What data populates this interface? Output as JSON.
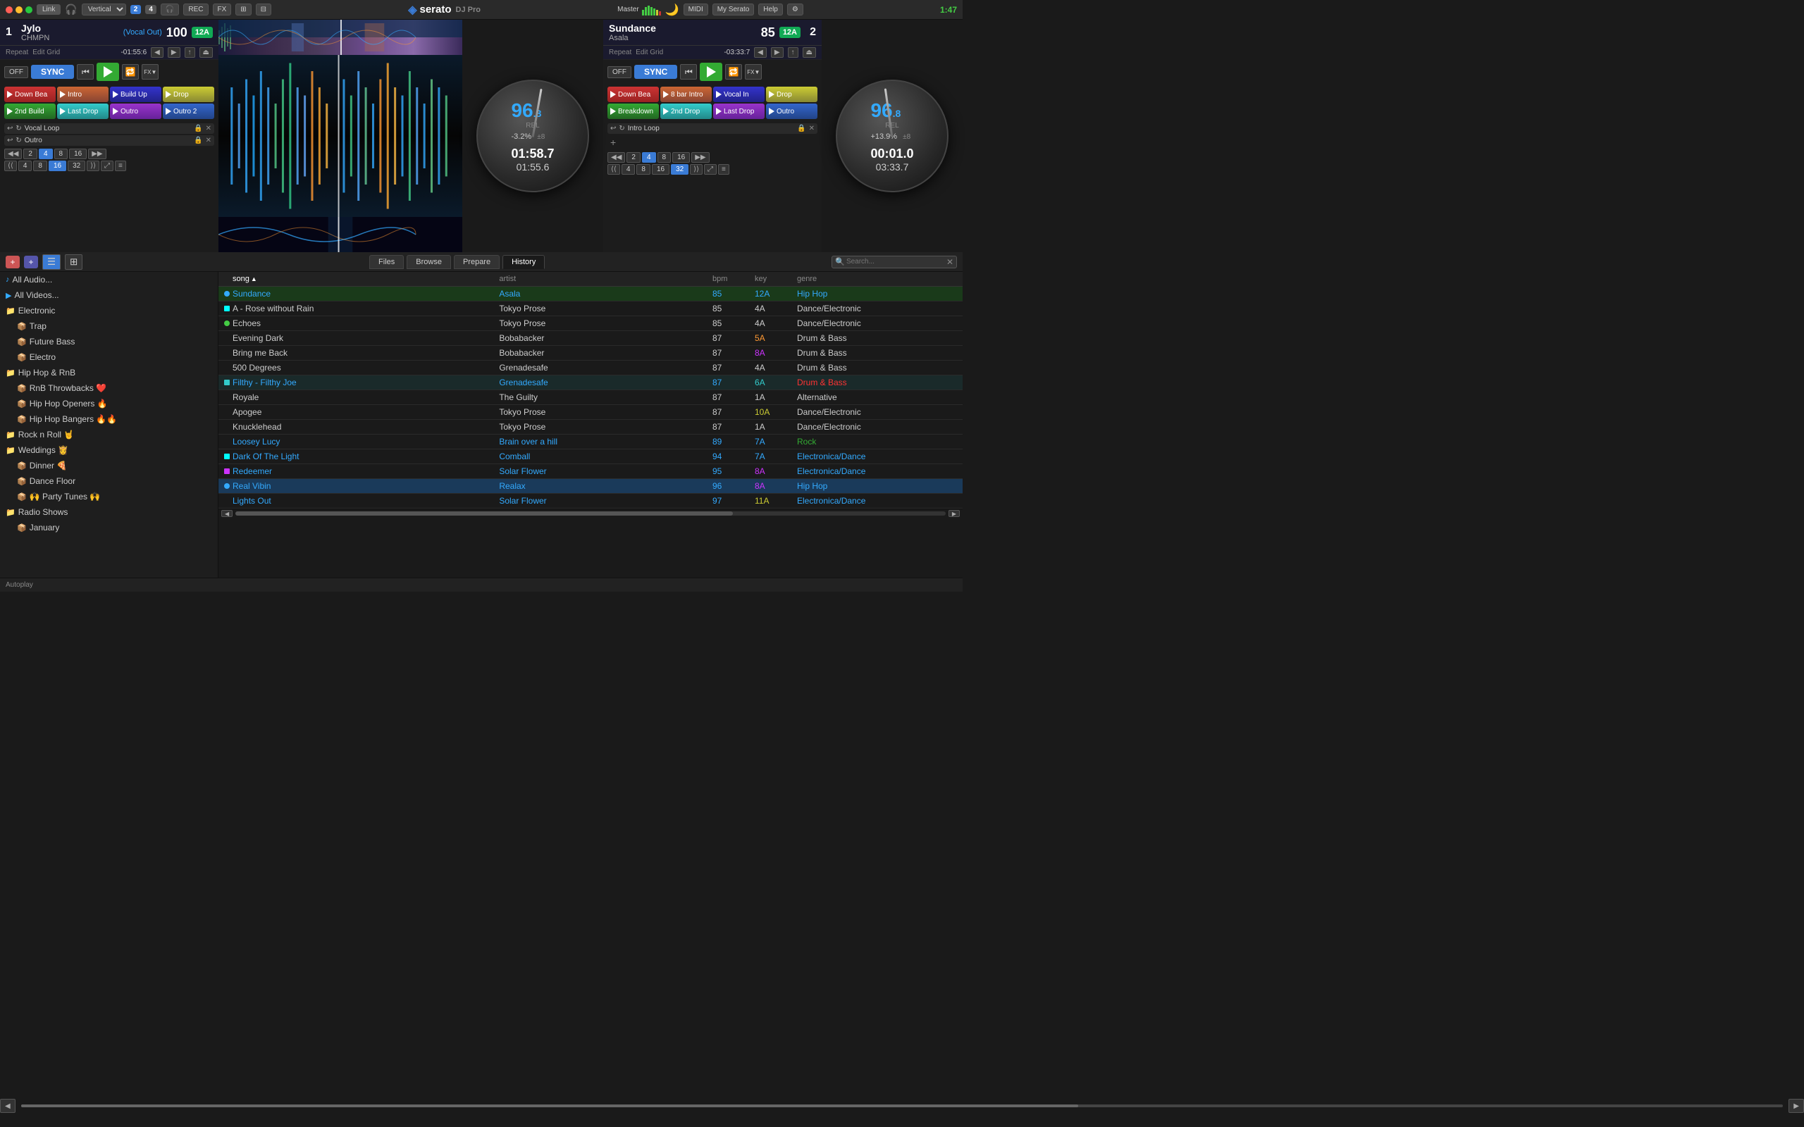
{
  "topbar": {
    "link_label": "Link",
    "layout_label": "Vertical",
    "badge1": "2",
    "badge2": "4",
    "rec_label": "REC",
    "fx_label": "FX",
    "midi_label": "MIDI",
    "myserato_label": "My Serato",
    "help_label": "Help",
    "settings_label": "⚙",
    "time": "1:47"
  },
  "deck1": {
    "num": "1",
    "title": "Jylo",
    "artist": "CHMPN",
    "cue": "(Vocal Out)",
    "bpm": "100",
    "key": "12A",
    "repeat_label": "Repeat",
    "edit_grid_label": "Edit Grid",
    "time_remaining": "-01:55:6",
    "time_elapsed": "01:58.7",
    "time_total": "01:55.6",
    "pitch_value": "-3.2%",
    "pitch_range": "±8",
    "platter_bpm": "96",
    "platter_bpm_dec": ".8",
    "platter_rel": "REL",
    "cue_points": [
      {
        "label": "Down Bea",
        "color": "red"
      },
      {
        "label": "Intro",
        "color": "orange"
      },
      {
        "label": "Build Up",
        "color": "blue"
      },
      {
        "label": "Drop",
        "color": "yellow"
      },
      {
        "label": "2nd Build",
        "color": "green"
      },
      {
        "label": "Last Drop",
        "color": "teal"
      },
      {
        "label": "Outro",
        "color": "purple"
      },
      {
        "label": "Outro 2",
        "color": "darkblue"
      }
    ],
    "loops": [
      {
        "label": "Vocal Loop"
      },
      {
        "label": "Outro"
      }
    ],
    "beat_nums": [
      "2",
      "4",
      "8",
      "16"
    ],
    "beat_nums2": [
      "4",
      "8",
      "16",
      "32"
    ],
    "active_beat": "4",
    "active_beat2": "16"
  },
  "deck2": {
    "num": "2",
    "title": "Sundance",
    "artist": "Asala",
    "cue": "",
    "bpm": "85",
    "key": "12A",
    "repeat_label": "Repeat",
    "edit_grid_label": "Edit Grid",
    "time_remaining": "-03:33:7",
    "time_elapsed": "00:01.0",
    "time_total": "03:33.7",
    "pitch_value": "+13.9%",
    "pitch_range": "±8",
    "platter_bpm": "96",
    "platter_bpm_dec": ".8",
    "platter_rel": "REL",
    "cue_points": [
      {
        "label": "Down Bea",
        "color": "red"
      },
      {
        "label": "8 bar Intro",
        "color": "orange"
      },
      {
        "label": "Vocal In",
        "color": "blue"
      },
      {
        "label": "Drop",
        "color": "yellow"
      },
      {
        "label": "Breakdown",
        "color": "green"
      },
      {
        "label": "2nd Drop",
        "color": "teal"
      },
      {
        "label": "Last Drop",
        "color": "purple"
      },
      {
        "label": "Outro",
        "color": "darkblue"
      }
    ],
    "loops": [
      {
        "label": "Intro Loop"
      }
    ],
    "beat_nums": [
      "2",
      "4",
      "8",
      "16"
    ],
    "beat_nums2": [
      "4",
      "8",
      "16",
      "32"
    ],
    "active_beat": "4",
    "active_beat2": "32"
  },
  "browser": {
    "tabs": [
      "Files",
      "Browse",
      "Prepare",
      "History"
    ],
    "active_tab": "History",
    "search_placeholder": "🔍",
    "columns": {
      "song": "song",
      "artist": "artist",
      "bpm": "bpm",
      "key": "key",
      "genre": "genre"
    },
    "tracks": [
      {
        "id": 1,
        "song": "Sundance",
        "artist": "Asala",
        "bpm": "85",
        "key": "12A",
        "genre": "Hip Hop",
        "highlight": true,
        "indicator": "blue"
      },
      {
        "id": 2,
        "song": "A - Rose without Rain",
        "artist": "Tokyo Prose",
        "bpm": "85",
        "key": "4A",
        "genre": "Dance/Electronic",
        "indicator": "cyan"
      },
      {
        "id": 3,
        "song": "Echoes",
        "artist": "Tokyo Prose",
        "bpm": "85",
        "key": "4A",
        "genre": "Dance/Electronic",
        "indicator": "green"
      },
      {
        "id": 4,
        "song": "Evening Dark",
        "artist": "Bobabacker",
        "bpm": "87",
        "key": "5A",
        "genre": "Drum & Bass"
      },
      {
        "id": 5,
        "song": "Bring me Back",
        "artist": "Bobabacker",
        "bpm": "87",
        "key": "8A",
        "genre": "Drum & Bass"
      },
      {
        "id": 6,
        "song": "500 Degrees",
        "artist": "Grenadesafe",
        "bpm": "87",
        "key": "4A",
        "genre": "Drum & Bass"
      },
      {
        "id": 7,
        "song": "Filthy - Filthy Joe",
        "artist": "Grenadesafe",
        "bpm": "87",
        "key": "6A",
        "genre": "Drum & Bass",
        "highlight": true,
        "indicator": "teal"
      },
      {
        "id": 8,
        "song": "Royale",
        "artist": "The Guilty",
        "bpm": "87",
        "key": "1A",
        "genre": "Alternative"
      },
      {
        "id": 9,
        "song": "Apogee",
        "artist": "Tokyo Prose",
        "bpm": "87",
        "key": "10A",
        "genre": "Dance/Electronic"
      },
      {
        "id": 10,
        "song": "Knucklehead",
        "artist": "Tokyo Prose",
        "bpm": "87",
        "key": "1A",
        "genre": "Dance/Electronic"
      },
      {
        "id": 11,
        "song": "Loosey Lucy",
        "artist": "Brain over a hill",
        "bpm": "89",
        "key": "7A",
        "genre": "Rock",
        "highlight": true
      },
      {
        "id": 12,
        "song": "Dark Of The Light",
        "artist": "Comball",
        "bpm": "94",
        "key": "7A",
        "genre": "Electronica/Dance",
        "highlight": true,
        "indicator": "cyan"
      },
      {
        "id": 13,
        "song": "Redeemer",
        "artist": "Solar Flower",
        "bpm": "95",
        "key": "8A",
        "genre": "Electronica/Dance",
        "highlight": true
      },
      {
        "id": 14,
        "song": "Real Vibin",
        "artist": "Realax",
        "bpm": "96",
        "key": "8A",
        "genre": "Hip Hop",
        "selected": true,
        "indicator": "blue"
      },
      {
        "id": 15,
        "song": "Lights Out",
        "artist": "Solar Flower",
        "bpm": "97",
        "key": "11A",
        "genre": "Electronica/Dance",
        "highlight": true
      }
    ]
  },
  "sidebar": {
    "items": [
      {
        "label": "All Audio...",
        "type": "all",
        "indent": 0
      },
      {
        "label": "All Videos...",
        "type": "all",
        "indent": 0
      },
      {
        "label": "Electronic",
        "type": "folder",
        "indent": 0
      },
      {
        "label": "Trap",
        "type": "subfolder",
        "indent": 1
      },
      {
        "label": "Future Bass",
        "type": "subfolder",
        "indent": 1
      },
      {
        "label": "Electro",
        "type": "subfolder",
        "indent": 1
      },
      {
        "label": "Hip Hop & RnB",
        "type": "folder",
        "indent": 0
      },
      {
        "label": "RnB Throwbacks ❤️",
        "type": "subfolder",
        "indent": 1
      },
      {
        "label": "Hip Hop Openers 🔥",
        "type": "subfolder",
        "indent": 1
      },
      {
        "label": "Hip Hop Bangers 🔥🔥",
        "type": "subfolder",
        "indent": 1
      },
      {
        "label": "Rock n Roll 🤘",
        "type": "folder",
        "indent": 0
      },
      {
        "label": "Weddings 👸",
        "type": "folder",
        "indent": 0
      },
      {
        "label": "Dinner 🍕",
        "type": "subfolder",
        "indent": 1
      },
      {
        "label": "Dance Floor",
        "type": "subfolder",
        "indent": 1
      },
      {
        "label": "🙌 Party Tunes 🙌",
        "type": "subfolder",
        "indent": 1
      },
      {
        "label": "Radio Shows",
        "type": "folder",
        "indent": 0
      },
      {
        "label": "January",
        "type": "subfolder",
        "indent": 1
      }
    ]
  },
  "autoplay": {
    "label": "Autoplay"
  }
}
